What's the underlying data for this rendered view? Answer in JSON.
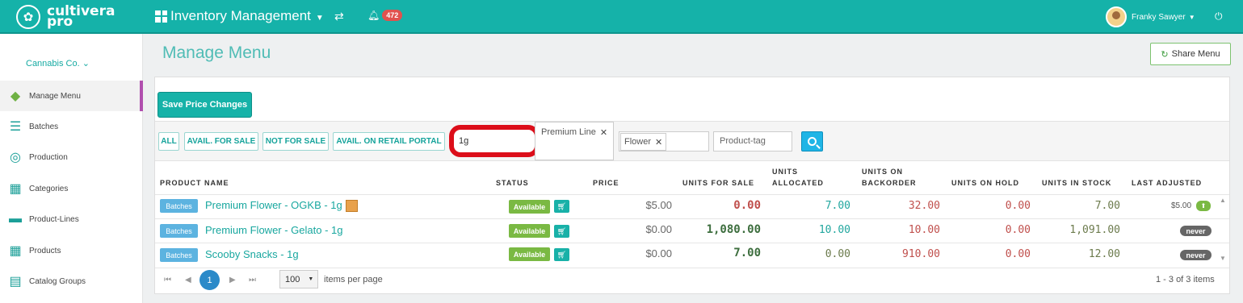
{
  "header": {
    "logo_line1": "cultivera",
    "logo_line2": "pro",
    "module": "Inventory Management",
    "notifications": "472",
    "user_name": "Franky Sawyer"
  },
  "sidebar": {
    "org": "Cannabis Co.",
    "items": [
      {
        "label": "Manage Menu",
        "icon": "leaf-icon"
      },
      {
        "label": "Batches",
        "icon": "list-icon"
      },
      {
        "label": "Production",
        "icon": "production-icon"
      },
      {
        "label": "Categories",
        "icon": "grid-icon"
      },
      {
        "label": "Product-Lines",
        "icon": "product-lines-icon"
      },
      {
        "label": "Products",
        "icon": "products-icon"
      },
      {
        "label": "Catalog Groups",
        "icon": "catalog-icon"
      }
    ]
  },
  "page": {
    "title": "Manage Menu",
    "share_label": "Share Menu",
    "save_label": "Save Price Changes"
  },
  "filters": {
    "buttons": [
      "ALL",
      "AVAIL. FOR SALE",
      "NOT FOR SALE",
      "AVAIL. ON RETAIL PORTAL"
    ],
    "search_value": "1g",
    "product_line_tag": "Premium Line",
    "category_tag": "Flower",
    "product_tag_placeholder": "Product-tag"
  },
  "table": {
    "columns": {
      "product_name": "PRODUCT NAME",
      "status": "STATUS",
      "price": "PRICE",
      "units_for_sale": "UNITS FOR SALE",
      "units_allocated_1": "UNITS",
      "units_allocated_2": "ALLOCATED",
      "units_backorder_1": "UNITS ON",
      "units_backorder_2": "BACKORDER",
      "units_on_hold": "UNITS ON HOLD",
      "units_in_stock": "UNITS IN STOCK",
      "last_adjusted": "LAST ADJUSTED"
    },
    "batches_label": "Batches",
    "rows": [
      {
        "name": "Premium Flower - OGKB - 1g",
        "status": "Available",
        "price": "$5.00",
        "for_sale": "0.00",
        "allocated": "7.00",
        "backorder": "32.00",
        "on_hold": "0.00",
        "in_stock": "7.00",
        "last_adjusted": "$5.00"
      },
      {
        "name": "Premium Flower - Gelato - 1g",
        "status": "Available",
        "price": "$0.00",
        "for_sale": "1,080.00",
        "allocated": "10.00",
        "backorder": "10.00",
        "on_hold": "0.00",
        "in_stock": "1,091.00",
        "last_adjusted": "never"
      },
      {
        "name": "Scooby Snacks - 1g",
        "status": "Available",
        "price": "$0.00",
        "for_sale": "7.00",
        "allocated": "0.00",
        "backorder": "910.00",
        "on_hold": "0.00",
        "in_stock": "12.00",
        "last_adjusted": "never"
      }
    ]
  },
  "pager": {
    "current_page": "1",
    "per_page": "100",
    "per_page_label": "items per page",
    "range": "1 - 3 of 3 items"
  }
}
